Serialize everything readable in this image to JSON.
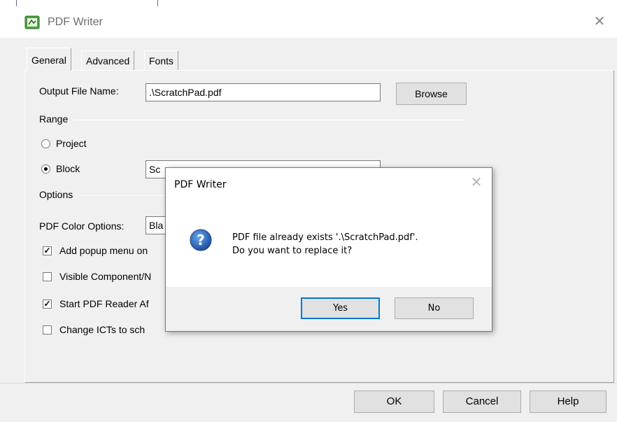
{
  "window": {
    "title": "PDF Writer",
    "close_glyph": "✕",
    "icon": "pdf-writer-app-icon"
  },
  "tabs": [
    {
      "label": "General",
      "active": true
    },
    {
      "label": "Advanced",
      "active": false
    },
    {
      "label": "Fonts",
      "active": false
    }
  ],
  "general": {
    "output_label": "Output File Name:",
    "output_value": ".\\ScratchPad.pdf",
    "browse_label": "Browse",
    "range_label": "Range",
    "project_label": "Project",
    "project_selected": false,
    "block_label": "Block",
    "block_selected": true,
    "block_value": "Sc",
    "options_label": "Options",
    "color_label": "PDF Color Options:",
    "color_value": "Bla",
    "opt_popup": {
      "label": "Add popup menu on",
      "checked": true
    },
    "opt_visible": {
      "label": "Visible Component/N",
      "checked": false
    },
    "opt_start": {
      "label": "Start PDF Reader Af",
      "checked": true
    },
    "opt_ict": {
      "label": "Change ICTs to sch",
      "checked": false
    }
  },
  "buttons": {
    "ok": "OK",
    "cancel": "Cancel",
    "help": "Help"
  },
  "modal": {
    "title": "PDF Writer",
    "close_glyph": "✕",
    "icon": "question-icon",
    "message_line1": "PDF file already exists '.\\ScratchPad.pdf'.",
    "message_line2": "Do you want to replace it?",
    "yes_label": "Yes",
    "no_label": "No"
  },
  "colors": {
    "dialog_bg": "#f0f0f0",
    "focus_border": "#0078d7",
    "question_icon": "#1c62b9"
  }
}
